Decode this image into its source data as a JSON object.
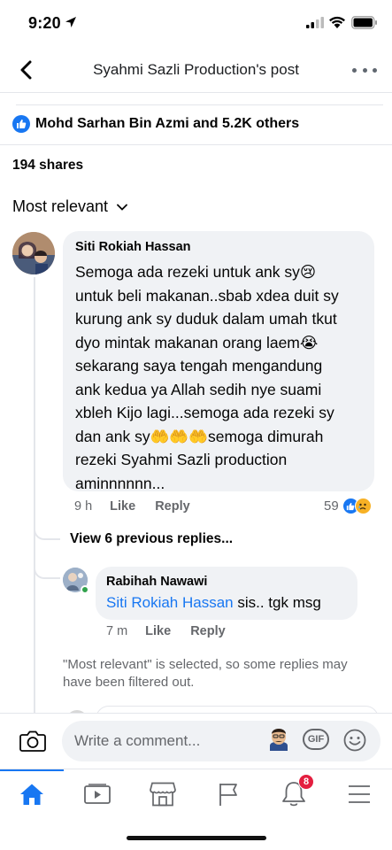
{
  "status_bar": {
    "time": "9:20"
  },
  "header": {
    "title": "Syahmi Sazli Production's post"
  },
  "reactions": {
    "summary": "Mohd Sarhan Bin Azmi and 5.2K others"
  },
  "shares": "194 shares",
  "sort": {
    "label": "Most relevant"
  },
  "comment": {
    "author": "Siti Rokiah Hassan",
    "text": "Semoga ada rezeki untuk ank sy😢\nuntuk beli makanan..sbab xdea duit sy\nkurung ank sy duduk dalam umah tkut\ndyo mintak makanan orang laem😭\nsekarang saya tengah mengandung\nank kedua ya Allah sedih nye suami\nxbleh Kijo lagi...semoga ada rezeki sy\ndan ank sy🤲🤲🤲semoga dimurah\nrezeki Syahmi Sazli production\naminnnnnn...",
    "time": "9 h",
    "like_label": "Like",
    "reply_label": "Reply",
    "reaction_count": "59"
  },
  "view_previous": "View 6 previous replies...",
  "reply": {
    "author": "Rabihah Nawawi",
    "mention": "Siti Rokiah Hassan",
    "text": " sis.. tgk msg",
    "time": "7 m",
    "like_label": "Like",
    "reply_label": "Reply"
  },
  "filter_note": "\"Most relevant\" is selected, so some replies may have been filtered out.",
  "composer": {
    "placeholder": "Write a comment...",
    "gif_label": "GIF"
  },
  "tabbar": {
    "items": [
      {
        "name": "home-icon",
        "active": true
      },
      {
        "name": "video-icon"
      },
      {
        "name": "marketplace-icon"
      },
      {
        "name": "pages-flag-icon"
      },
      {
        "name": "bell-icon"
      },
      {
        "name": "menu-icon"
      }
    ],
    "notification_badge": "8"
  },
  "colors": {
    "accent": "#1877f2",
    "bubble": "#f0f2f5",
    "muted": "#65676b",
    "badge": "#e41e3f"
  }
}
